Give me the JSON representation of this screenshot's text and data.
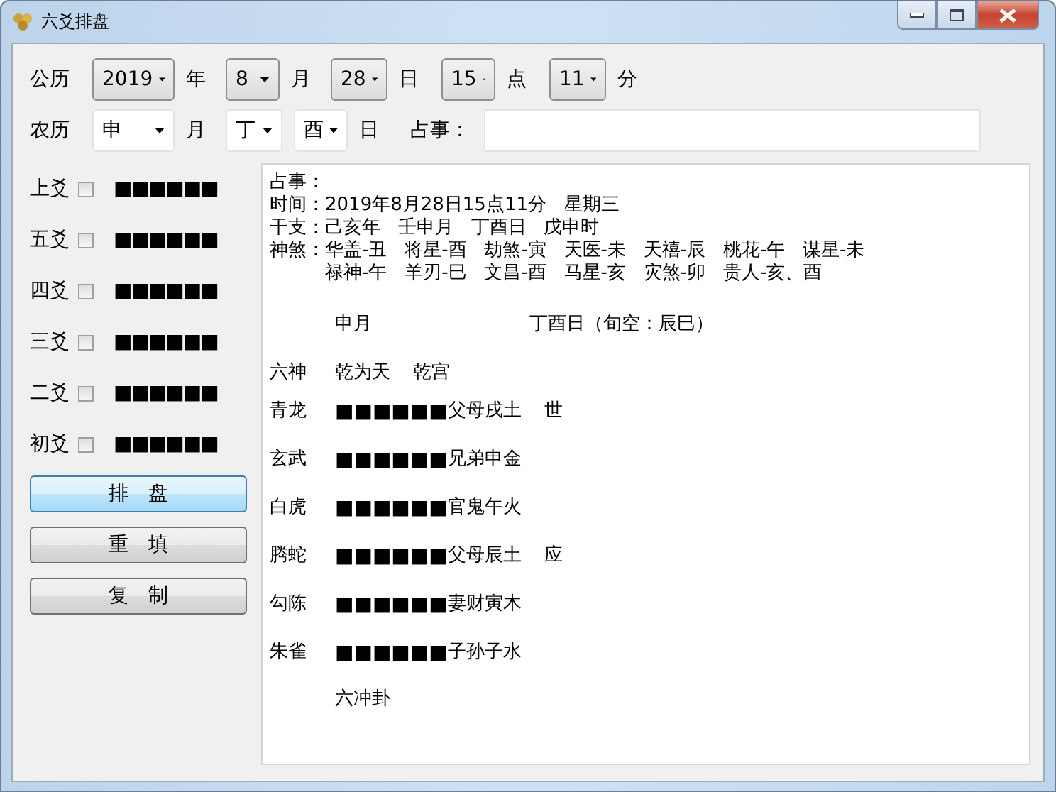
{
  "window": {
    "title": "六爻排盘"
  },
  "solar": {
    "label": "公历",
    "fields": [
      {
        "value": "2019",
        "unit": "年"
      },
      {
        "value": "8",
        "unit": "月"
      },
      {
        "value": "28",
        "unit": "日"
      },
      {
        "value": "15",
        "unit": "点"
      },
      {
        "value": "11",
        "unit": "分"
      }
    ]
  },
  "lunar": {
    "label": "农历",
    "fields": [
      {
        "value": "申",
        "unit": "月"
      },
      {
        "value": "丁"
      },
      {
        "value": "酉",
        "unit": "日"
      }
    ],
    "question_label": "占事："
  },
  "yao": [
    {
      "label": "上爻",
      "checked": false,
      "lines": "■■■■■■"
    },
    {
      "label": "五爻",
      "checked": false,
      "lines": "■■■■■■"
    },
    {
      "label": "四爻",
      "checked": false,
      "lines": "■■■■■■"
    },
    {
      "label": "三爻",
      "checked": false,
      "lines": "■■■■■■"
    },
    {
      "label": "二爻",
      "checked": false,
      "lines": "■■■■■■"
    },
    {
      "label": "初爻",
      "checked": false,
      "lines": "■■■■■■"
    }
  ],
  "buttons": [
    {
      "label": "排　盘",
      "focused": true
    },
    {
      "label": "重　填",
      "focused": false
    },
    {
      "label": "复　制",
      "focused": false
    }
  ],
  "result": {
    "info": [
      "占事：",
      "时间：2019年8月28日15点11分   星期三",
      "干支：己亥年   壬申月   丁酉日   戊申时"
    ],
    "shensha": {
      "label": "神煞：",
      "rows": [
        "华盖-丑   将星-酉   劫煞-寅   天医-未   天禧-辰   桃花-午   谋星-未",
        "禄神-午   羊刃-巳   文昌-酉   马星-亥   灾煞-卯   贵人-亥、酉"
      ]
    },
    "month": "申月",
    "day": "丁酉日（旬空：辰巳）",
    "header": {
      "label": "六神",
      "gua": "乾为天",
      "palace": "乾宫"
    },
    "rows": [
      {
        "god": "青龙",
        "lines": "■■■■■■",
        "relation": "父母戌土",
        "mark": "世"
      },
      {
        "god": "玄武",
        "lines": "■■■■■■",
        "relation": "兄弟申金"
      },
      {
        "god": "白虎",
        "lines": "■■■■■■",
        "relation": "官鬼午火"
      },
      {
        "god": "腾蛇",
        "lines": "■■■■■■",
        "relation": "父母辰土",
        "mark": "应"
      },
      {
        "god": "勾陈",
        "lines": "■■■■■■",
        "relation": "妻财寅木"
      },
      {
        "god": "朱雀",
        "lines": "■■■■■■",
        "relation": "子孙子水"
      }
    ],
    "footer": "六冲卦"
  }
}
